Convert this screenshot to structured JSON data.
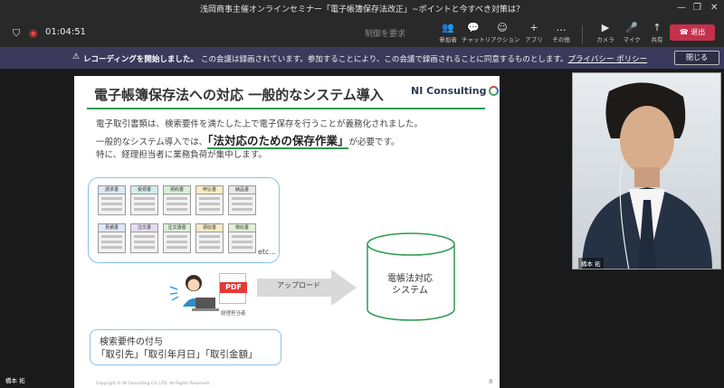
{
  "window": {
    "title": "浅岡商事主催オンラインセミナー「電子帳簿保存法改正」~ポイントと今すべき対策は？",
    "controls": [
      "—",
      "❐",
      "✕"
    ]
  },
  "toolbar": {
    "timer": "01:04:51",
    "request_control": "制御を要求",
    "buttons": [
      {
        "icon": "👥",
        "label": "参加者"
      },
      {
        "icon": "💬",
        "label": "チャット"
      },
      {
        "icon": "☺",
        "label": "リアクション"
      },
      {
        "icon": "+",
        "label": "アプリ"
      },
      {
        "icon": "…",
        "label": "その他"
      },
      {
        "icon": "▶",
        "label": "カメラ"
      },
      {
        "icon": "🎤",
        "label": "マイク"
      },
      {
        "icon": "↑",
        "label": "共有"
      }
    ],
    "leave_label": "退出"
  },
  "banner": {
    "title": "レコーディングを開始しました。",
    "message": "この会議は録画されています。参加することにより、この会議で録画されることに同意するものとします。",
    "link": "プライバシー ポリシー",
    "close_label": "閉じる"
  },
  "slide": {
    "title": "電子帳簿保存法への対応 一般的なシステム導入",
    "logo": "NI Consulting",
    "line1": "電子取引書類は、検索要件を満たした上で電子保存を行うことが義務化されました。",
    "line2_pre": "一般的なシステム導入では、",
    "line2_hl": "「法対応のための保存作業」",
    "line2_post": "が必要です。",
    "line3": "特に、経理担当者に業務負荷が集中します。",
    "documents": [
      "請求書",
      "受領書",
      "契約書",
      "申込書",
      "納品書",
      "見積書",
      "注文書",
      "注文請書",
      "領収書",
      "検収書"
    ],
    "etc": "etc...",
    "pdf_label": "PDF",
    "accountant_label": "経理担当者",
    "upload_label": "アップロード",
    "system_label_1": "電帳法対応",
    "system_label_2": "システム",
    "search_title": "検索要件の付与",
    "search_items": "「取引先」「取引年月日」「取引金額」",
    "copyright": "Copyright © NI Consulting CO.,LTD. All Rights Reserved.",
    "page": "8"
  },
  "video": {
    "participant_name": "橋本 拓"
  },
  "self_name": "橋本 拓"
}
